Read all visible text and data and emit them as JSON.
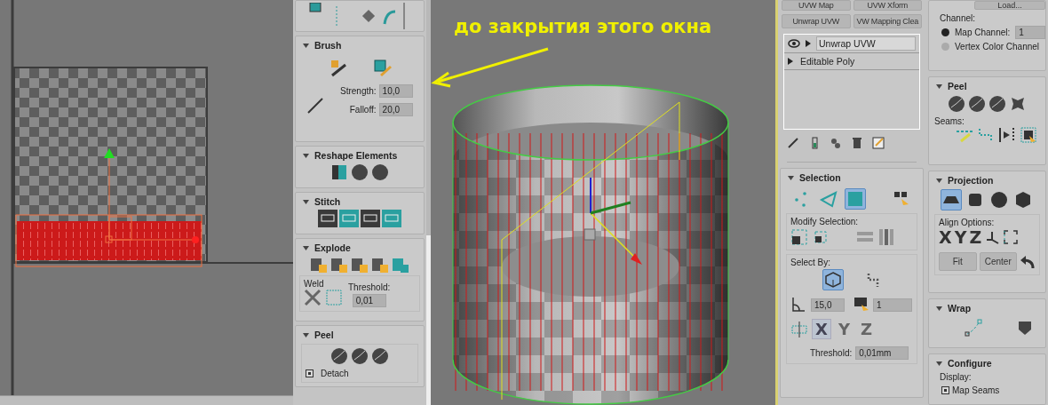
{
  "annotation": {
    "text": "до закрытия этого окна"
  },
  "uv_panel": {
    "brush": {
      "title": "Brush",
      "strength_label": "Strength:",
      "strength": "10,0",
      "falloff_label": "Falloff:",
      "falloff": "20,0"
    },
    "reshape": {
      "title": "Reshape Elements"
    },
    "stitch": {
      "title": "Stitch"
    },
    "explode": {
      "title": "Explode",
      "weld_label": "Weld",
      "threshold_label": "Threshold:",
      "threshold": "0,01"
    },
    "peel": {
      "title": "Peel",
      "detach": {
        "label": "Detach",
        "checked": true
      }
    }
  },
  "modifier_panel": {
    "buttons": [
      "UVW Map",
      "UVW Xform",
      "Unwrap UVW",
      "VW Mapping Clea"
    ],
    "stack": [
      {
        "label": "Unwrap UVW",
        "selected": true
      },
      {
        "label": "Editable Poly",
        "selected": false
      }
    ],
    "selection": {
      "title": "Selection",
      "modes": [
        {
          "selected": false
        },
        {
          "selected": false
        },
        {
          "selected": true
        }
      ],
      "modify_label": "Modify Selection:",
      "select_by_label": "Select By:",
      "select_by_element": {
        "selected": true
      },
      "angle": "15,0",
      "count": "1",
      "axes": [
        {
          "label": "X",
          "selected": true
        },
        {
          "label": "Y",
          "selected": false
        },
        {
          "label": "Z",
          "selected": false
        }
      ],
      "threshold_label": "Threshold:",
      "threshold": "0,01mm"
    }
  },
  "right_panel": {
    "load_button": "Load...",
    "channel_label": "Channel:",
    "channels": [
      {
        "label": "Map Channel:",
        "selected": true,
        "value": "1"
      },
      {
        "label": "Vertex Color Channel",
        "selected": false
      }
    ],
    "peel": {
      "title": "Peel",
      "seams_label": "Seams:"
    },
    "projection": {
      "title": "Projection",
      "modes": [
        {
          "selected": true
        },
        {
          "selected": false
        },
        {
          "selected": false
        },
        {
          "selected": false
        }
      ],
      "align_label": "Align Options:",
      "axes": [
        "X",
        "Y",
        "Z"
      ],
      "buttons": [
        "Fit",
        "Center"
      ]
    },
    "wrap": {
      "title": "Wrap"
    },
    "configure": {
      "title": "Configure",
      "display_label": "Display:",
      "map_seams": {
        "label": "Map Seams",
        "checked": true
      }
    }
  }
}
